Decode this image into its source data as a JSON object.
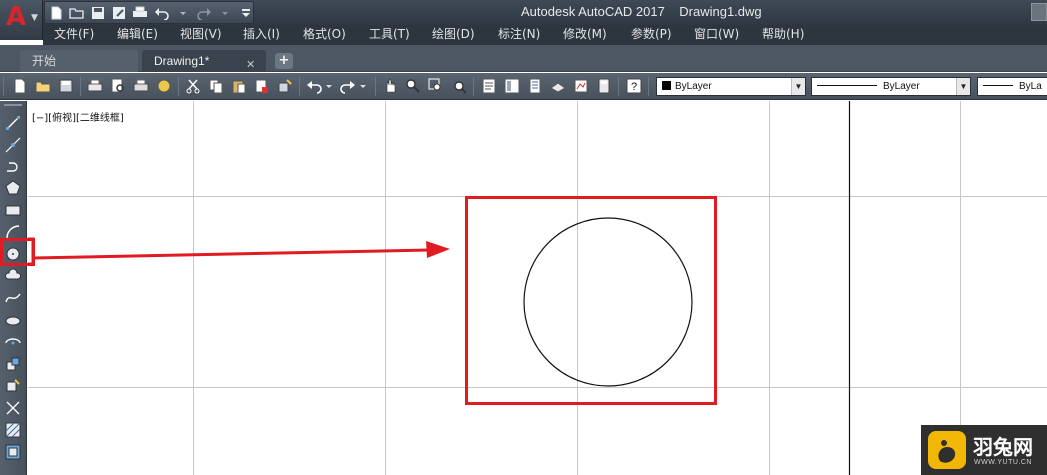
{
  "app": {
    "logo_letter": "A",
    "title": "Autodesk AutoCAD 2017    Drawing1.dwg"
  },
  "menu": {
    "items": [
      "文件(F)",
      "编辑(E)",
      "视图(V)",
      "插入(I)",
      "格式(O)",
      "工具(T)",
      "绘图(D)",
      "标注(N)",
      "修改(M)",
      "参数(P)",
      "窗口(W)",
      "帮助(H)"
    ]
  },
  "tabs": {
    "start_label": "开始",
    "drawing_label": "Drawing1*",
    "close_glyph": "✕",
    "add_glyph": "+"
  },
  "properties": {
    "color_value": "ByLayer",
    "linetype_value": "ByLayer",
    "lineweight_value": "ByLa"
  },
  "viewport": {
    "label": "[−][俯视][二维线框]"
  },
  "watermark": {
    "name": "羽兔网",
    "url": "WWW.YUTU.CN"
  },
  "colors": {
    "accent_red": "#e01b22",
    "logo_red": "#d8262c",
    "watermark_yellow": "#f2b705"
  },
  "icons": {
    "left_toolbar": [
      "line-icon",
      "construction-line-icon",
      "polyline-icon",
      "polygon-icon",
      "rectangle-icon",
      "arc-icon",
      "circle-icon",
      "revision-cloud-icon",
      "spline-icon",
      "ellipse-icon",
      "ellipse-arc-icon",
      "insert-block-icon",
      "make-block-icon",
      "point-icon",
      "hatch-icon",
      "region-icon"
    ]
  }
}
